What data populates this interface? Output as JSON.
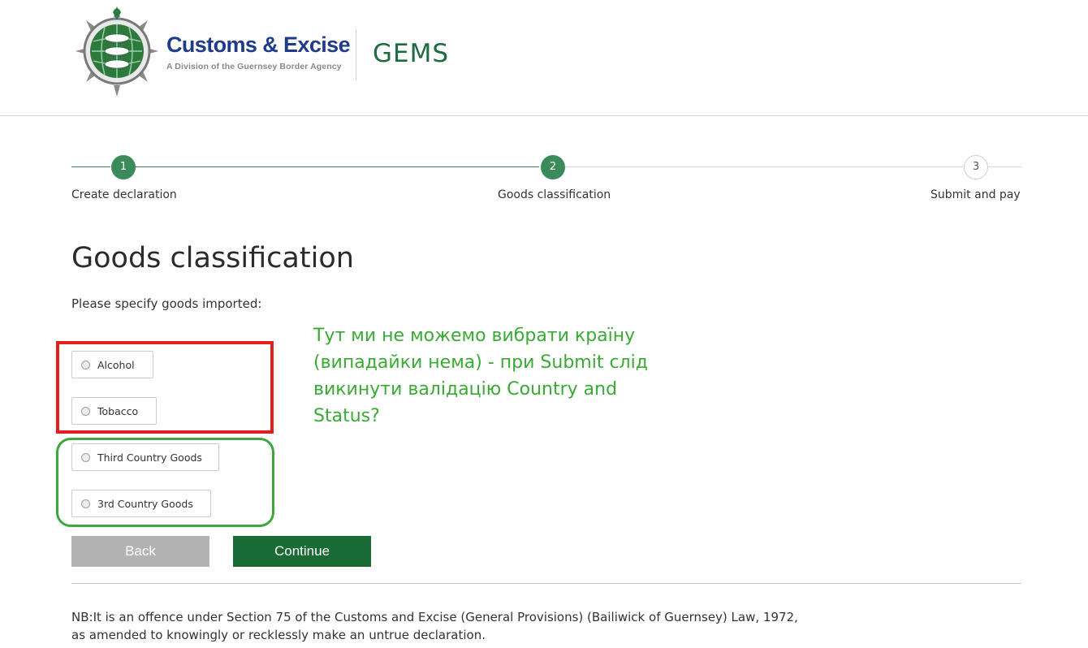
{
  "header": {
    "logo_title": "Customs & Excise",
    "logo_subtitle": "A Division of the Guernsey Border Agency",
    "app_name": "GEMS"
  },
  "steps": [
    {
      "number": "1",
      "label": "Create declaration",
      "state": "done"
    },
    {
      "number": "2",
      "label": "Goods classification",
      "state": "current"
    },
    {
      "number": "3",
      "label": "Submit and pay",
      "state": "todo"
    }
  ],
  "page_title": "Goods classification",
  "prompt": "Please specify goods imported:",
  "options": [
    {
      "label": "Alcohol",
      "selected": false
    },
    {
      "label": "Tobacco",
      "selected": false
    },
    {
      "label": "Third Country Goods",
      "selected": false
    },
    {
      "label": "3rd Country Goods",
      "selected": false
    }
  ],
  "annotation_note": "Тут ми не можемо вибрати країну (випадайки нема) - при Submit слід викинути валідацію Country and Status?",
  "buttons": {
    "back": "Back",
    "continue": "Continue"
  },
  "notice": "NB:It is an offence under Section 75 of the Customs and Excise (General Provisions) (Bailiwick of Guernsey) Law, 1972, as amended to knowingly or recklessly make an untrue declaration.",
  "colors": {
    "brand_green": "#1a6a33",
    "step_green": "#3b8a5a",
    "logo_blue": "#1f3b8c",
    "annotation_red": "#e02020",
    "annotation_green": "#3aa83a"
  }
}
